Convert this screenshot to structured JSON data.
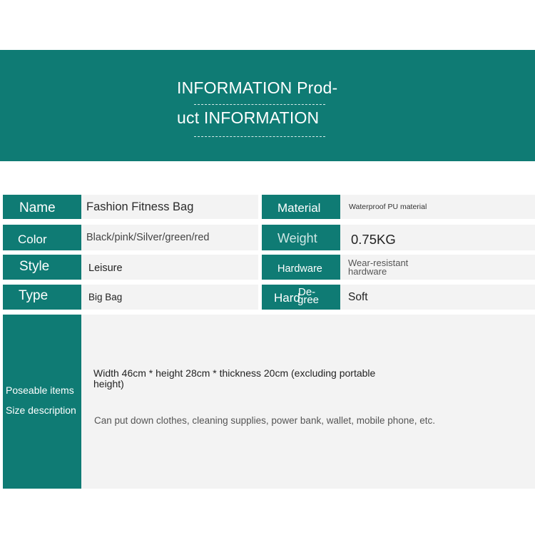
{
  "header": {
    "title_line1": "INFORMATION Prod-",
    "title_line2": "uct INFORMATION"
  },
  "rows": [
    {
      "label_left": "Name",
      "value_left": "Fashion Fitness Bag",
      "label_right": "Material",
      "value_right": "Waterproof PU material"
    },
    {
      "label_left": "Color",
      "value_left": "Black/pink/Silver/green/red",
      "label_right": "Weight",
      "value_right": "0.75KG"
    },
    {
      "label_left": "Style",
      "value_left": "Leisure",
      "label_right": "Hardware",
      "value_right_line1": "Wear-resistant",
      "value_right_line2": "hardware"
    },
    {
      "label_left": "Type",
      "value_left": "Big Bag",
      "label_right_line1": "Hard",
      "label_right_line2": "De-",
      "label_right_line3": "gree",
      "value_right": "Soft"
    }
  ],
  "description": {
    "label_items": "Poseable items",
    "label_size": "Size description",
    "size_text": "Width 46cm * height 28cm * thickness 20cm (excluding portable height)",
    "items_text": "Can put down clothes, cleaning supplies, power bank, wallet, mobile phone, etc."
  },
  "colors": {
    "accent": "#0f7b74",
    "cell_background": "#f3f3f3",
    "page_background": "#ffffff"
  }
}
